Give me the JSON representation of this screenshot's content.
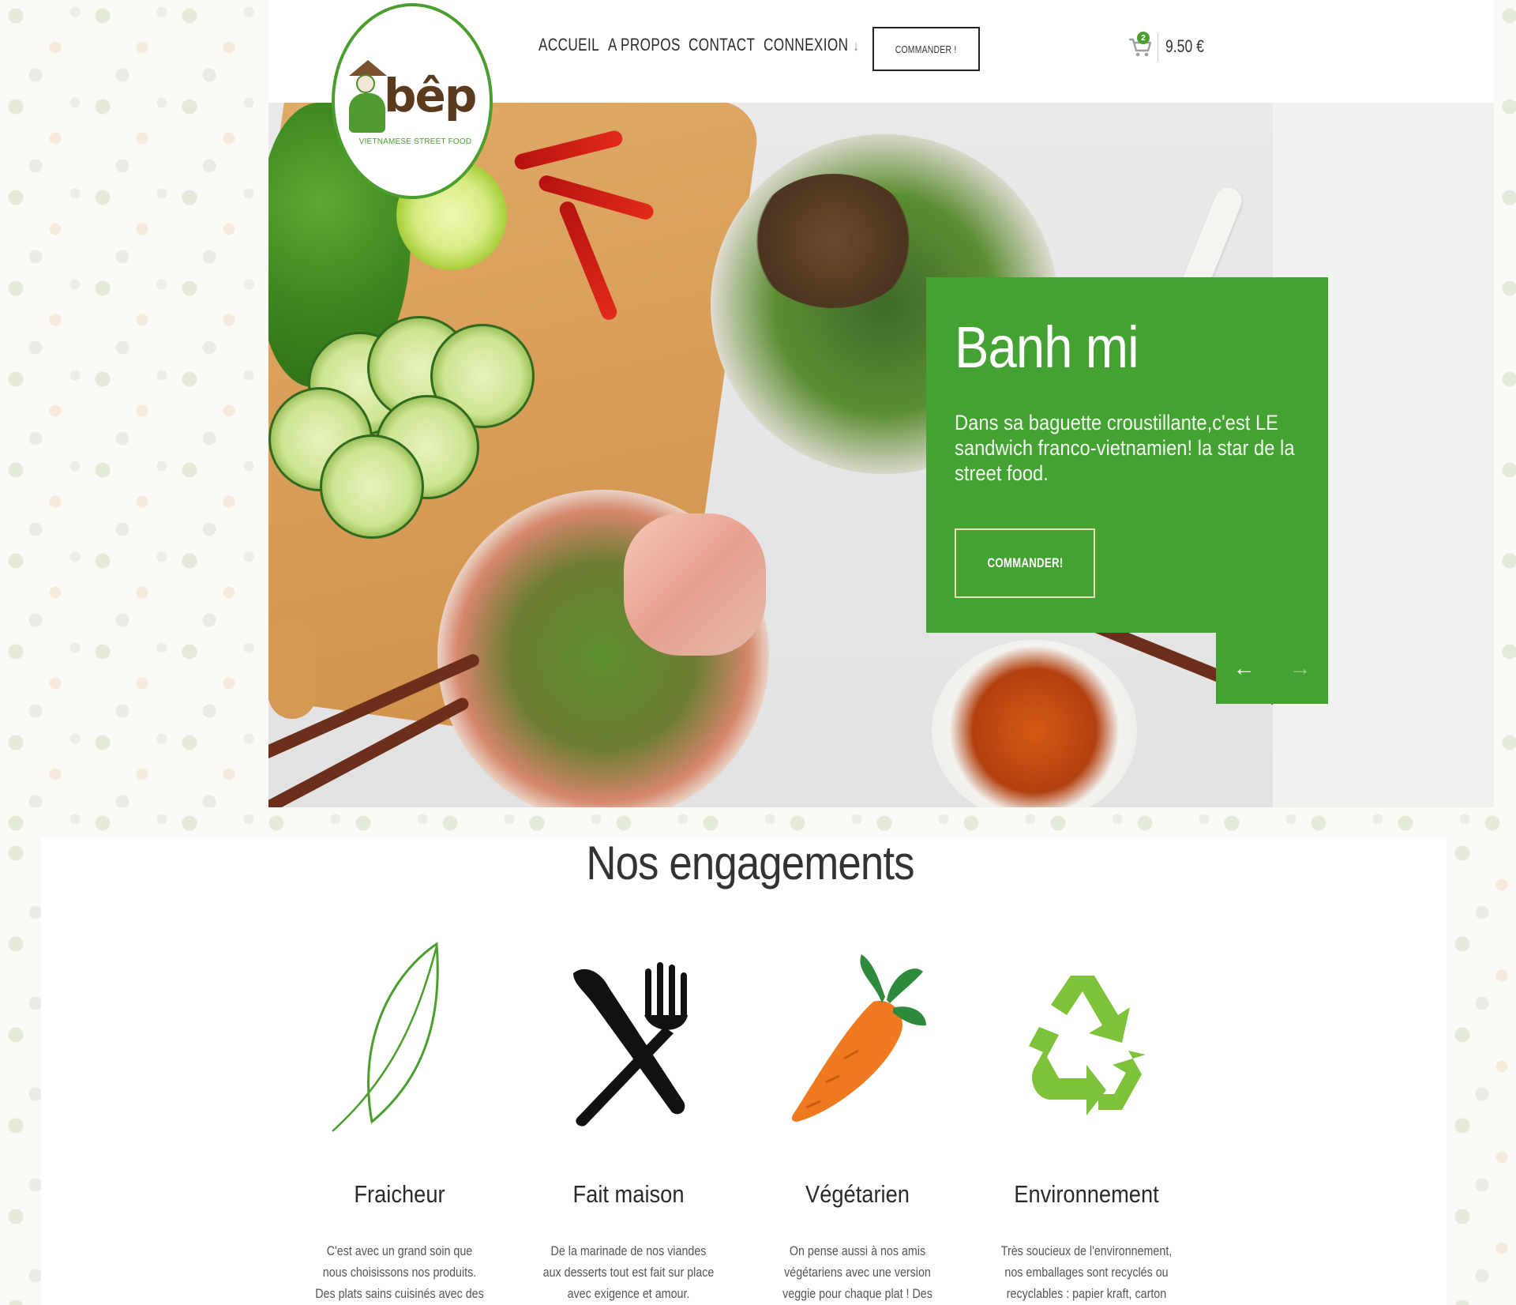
{
  "brand": {
    "name": "bêp",
    "tagline": "VIETNAMESE STREET FOOD",
    "primary_color": "#44a232",
    "accent_brown": "#5b3a1e"
  },
  "nav": {
    "items": [
      {
        "label": "ACCUEIL"
      },
      {
        "label": "A PROPOS"
      },
      {
        "label": "CONTACT"
      },
      {
        "label": "CONNEXION",
        "has_dropdown": true
      }
    ],
    "order_button": "COMMANDER !",
    "cart": {
      "count": "2",
      "total": "9.50 €",
      "icon": "cart-icon"
    }
  },
  "hero": {
    "title": "Banh mi",
    "description": "Dans sa baguette croustillante,c'est LE sandwich franco-vietnamien! la star de la street food.",
    "button": "COMMANDER!",
    "prev_icon": "arrow-left-icon",
    "next_icon": "arrow-right-icon"
  },
  "engagements": {
    "title": "Nos engagements",
    "items": [
      {
        "icon": "leaf-icon",
        "title": "Fraicheur",
        "text": "C'est avec un grand soin que nous choisissons nos produits. Des plats sains cuisinés avec des ingrédients de"
      },
      {
        "icon": "cutlery-icon",
        "title": "Fait maison",
        "text": "De la marinade de nos viandes aux desserts tout est fait sur place avec exigence et amour."
      },
      {
        "icon": "carrot-icon",
        "title": "Végétarien",
        "text": "On pense aussi à nos amis végétariens avec une version veggie pour chaque plat ! Des nems aux légumes pour le"
      },
      {
        "icon": "recycle-icon",
        "title": "Environnement",
        "text": "Très soucieux de l'environnement, nos emballages sont recyclés ou recyclables : papier kraft, carton kraft,"
      }
    ]
  }
}
